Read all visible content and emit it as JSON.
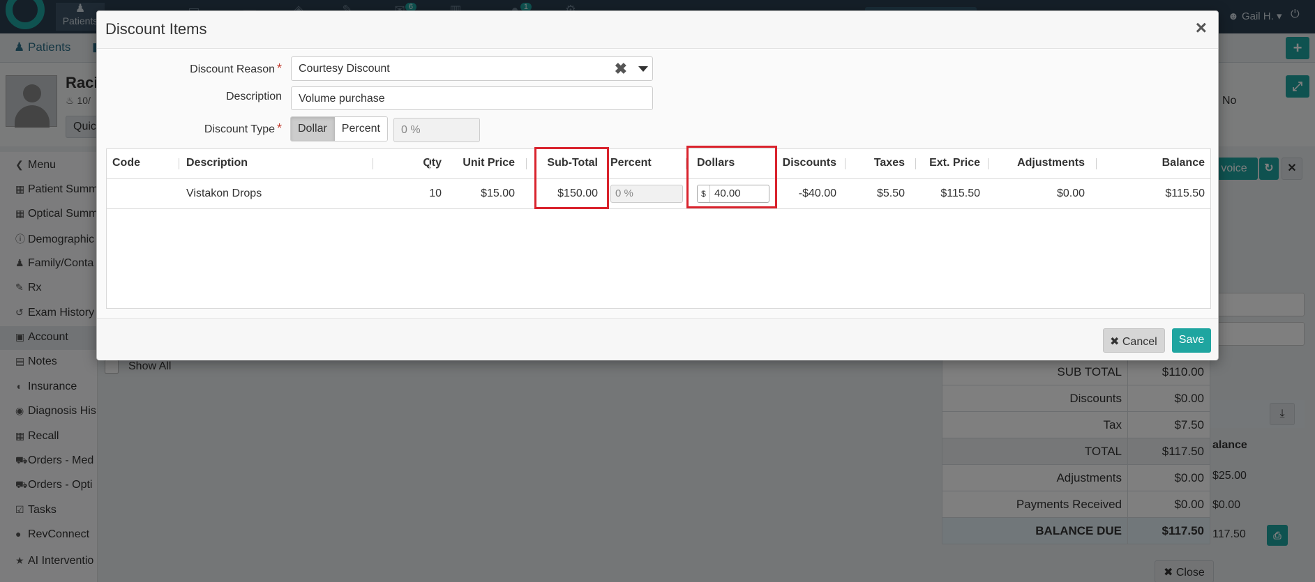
{
  "app": {
    "nav_items": [
      {
        "label": "Patients",
        "icon": "users-icon"
      }
    ],
    "nav_badges": [
      "6",
      "1"
    ],
    "user": "Gail H.",
    "subnav_tab": "Patients",
    "patient_name": "Raci",
    "patient_sub": "10/",
    "quick_button": "Quic",
    "no_text": "No",
    "sidebar": [
      {
        "label": "Menu",
        "icon": "chevron-left-icon"
      },
      {
        "label": "Patient Summ",
        "icon": "grid-icon"
      },
      {
        "label": "Optical Summ",
        "icon": "grid-icon"
      },
      {
        "label": "Demographic",
        "icon": "info-icon"
      },
      {
        "label": "Family/Conta",
        "icon": "users-icon"
      },
      {
        "label": "Rx",
        "icon": "edit-icon"
      },
      {
        "label": "Exam History",
        "icon": "history-icon"
      },
      {
        "label": "Account",
        "icon": "money-icon"
      },
      {
        "label": "Notes",
        "icon": "notes-icon"
      },
      {
        "label": "Insurance",
        "icon": "shield-icon"
      },
      {
        "label": "Diagnosis His",
        "icon": "eye-icon"
      },
      {
        "label": "Recall",
        "icon": "calendar-icon"
      },
      {
        "label": "Orders - Med",
        "icon": "cart-icon"
      },
      {
        "label": "Orders - Opti",
        "icon": "cart-icon"
      },
      {
        "label": "Tasks",
        "icon": "check-icon"
      },
      {
        "label": "RevConnect",
        "icon": "chat-icon"
      },
      {
        "label": "AI Interventio",
        "icon": "star-icon"
      }
    ],
    "show_all": "Show All",
    "invoice_button": "voice",
    "balance_header": "alance",
    "balance_col": [
      "$25.00",
      "$0.00",
      "117.50"
    ],
    "summary": [
      {
        "label": "SUB TOTAL",
        "value": "$110.00"
      },
      {
        "label": "Discounts",
        "value": "$0.00"
      },
      {
        "label": "Tax",
        "value": "$7.50"
      },
      {
        "label": "TOTAL",
        "value": "$117.50"
      },
      {
        "label": "Adjustments",
        "value": "$0.00"
      },
      {
        "label": "Payments Received",
        "value": "$0.00"
      },
      {
        "label": "BALANCE DUE",
        "value": "$117.50"
      }
    ],
    "close_button": "Close"
  },
  "modal": {
    "title": "Discount Items",
    "close_glyph": "×",
    "form": {
      "reason_label": "Discount Reason",
      "reason_value": "Courtesy Discount",
      "description_label": "Description",
      "description_value": "Volume purchase",
      "type_label": "Discount Type",
      "type_options": [
        "Dollar",
        "Percent"
      ],
      "type_selected": "Dollar",
      "percent_value": "0 %",
      "required_mark": "*"
    },
    "grid": {
      "columns": [
        "Code",
        "Description",
        "Qty",
        "Unit Price",
        "Sub-Total",
        "Percent",
        "Dollars",
        "Discounts",
        "Taxes",
        "Ext. Price",
        "Adjustments",
        "Balance"
      ],
      "rows": [
        {
          "code": "",
          "description": "Vistakon Drops",
          "qty": "10",
          "unit_price": "$15.00",
          "sub_total": "$150.00",
          "percent": "0 %",
          "dollar_addon": "$",
          "dollars": "40.00",
          "discounts": "-$40.00",
          "taxes": "$5.50",
          "ext_price": "$115.50",
          "adjustments": "$0.00",
          "balance": "$115.50"
        }
      ]
    },
    "footer": {
      "cancel_label": "Cancel",
      "save_label": "Save"
    }
  },
  "colors": {
    "accent": "#1fa5a0",
    "highlight": "#d9232d",
    "topbar": "#2b3e50"
  }
}
